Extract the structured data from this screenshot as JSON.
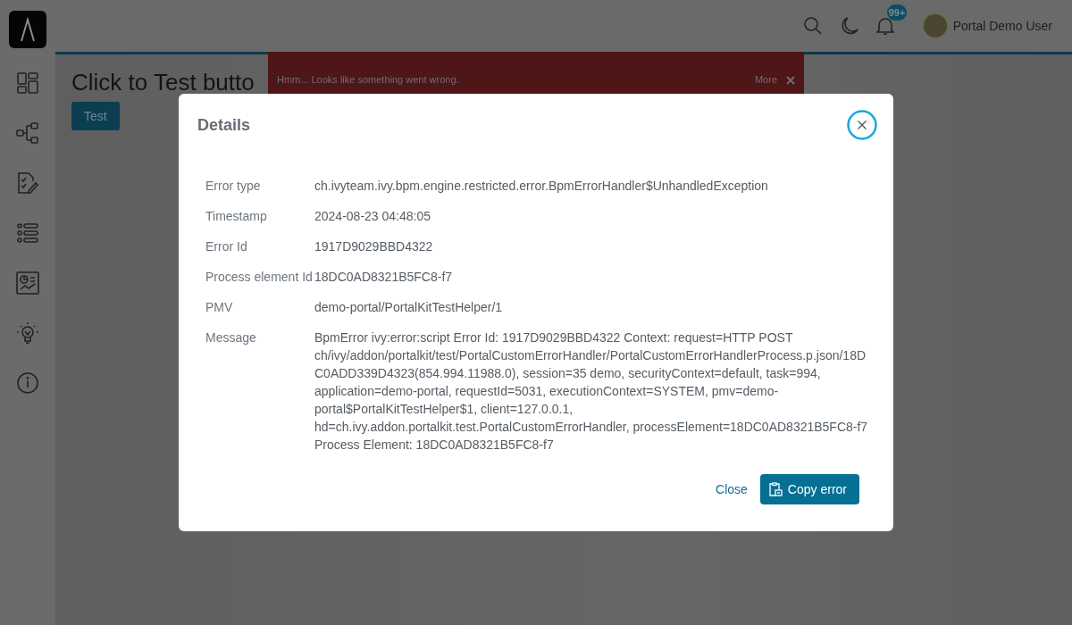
{
  "header": {
    "notification_count": "99+",
    "user_name": "Portal Demo User"
  },
  "sidebar": {
    "items": [
      {
        "kind": "dashboard"
      },
      {
        "kind": "process"
      },
      {
        "kind": "tasks"
      },
      {
        "kind": "list"
      },
      {
        "kind": "statistics"
      },
      {
        "kind": "idea"
      },
      {
        "kind": "info"
      }
    ]
  },
  "page": {
    "title": "Click to Test butto",
    "button": "Test"
  },
  "toast": {
    "message": "Hmm... Looks like something went wrong.",
    "more": "More"
  },
  "dialog": {
    "title": "Details",
    "fields": [
      {
        "label": "Error type",
        "value": "ch.ivyteam.ivy.bpm.engine.restricted.error.BpmErrorHandler$UnhandledException"
      },
      {
        "label": "Timestamp",
        "value": "2024-08-23 04:48:05"
      },
      {
        "label": "Error Id",
        "value": "1917D9029BBD4322"
      },
      {
        "label": "Process element Id",
        "value": "18DC0AD8321B5FC8-f7"
      },
      {
        "label": "PMV",
        "value": "demo-portal/PortalKitTestHelper/1"
      },
      {
        "label": "Message",
        "value": "BpmError ivy:error:script Error Id: 1917D9029BBD4322 Context: request=HTTP POST ch/ivy/addon/portalkit/test/PortalCustomErrorHandler/PortalCustomErrorHandlerProcess.p.json/18DC0ADD339D4323(854.994.11988.0), session=35 demo, securityContext=default, task=994, application=demo-portal, requestId=5031, executionContext=SYSTEM, pmv=demo-portal$PortalKitTestHelper$1, client=127.0.0.1, hd=ch.ivy.addon.portalkit.test.PortalCustomErrorHandler, processElement=18DC0AD8321B5FC8-f7 Process Element: 18DC0AD8321B5FC8-f7"
      }
    ],
    "close_link": "Close",
    "copy_button": "Copy error"
  }
}
